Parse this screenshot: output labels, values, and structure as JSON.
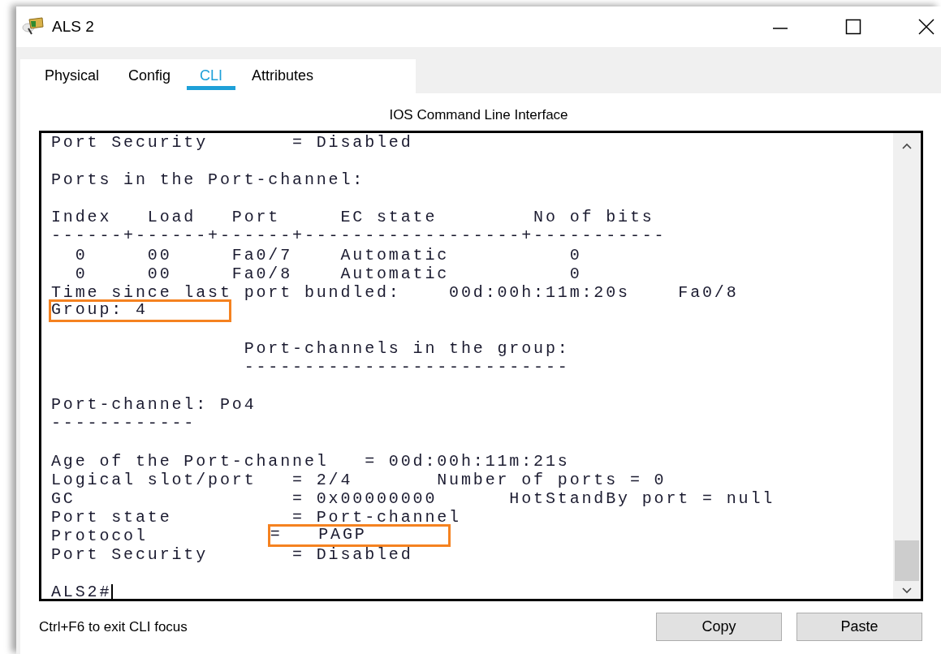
{
  "window": {
    "title": "ALS 2"
  },
  "tabs": [
    {
      "label": "Physical",
      "selected": false
    },
    {
      "label": "Config",
      "selected": false
    },
    {
      "label": "CLI",
      "selected": true
    },
    {
      "label": "Attributes",
      "selected": false
    }
  ],
  "panel_title": "IOS Command Line Interface",
  "terminal": {
    "lines": [
      {
        "kind": "text",
        "text": "Port Security       = Disabled"
      },
      {
        "kind": "blank"
      },
      {
        "kind": "text",
        "text": "Ports in the Port-channel:"
      },
      {
        "kind": "blank"
      },
      {
        "kind": "text",
        "text": "Index   Load   Port     EC state        No of bits"
      },
      {
        "kind": "text",
        "text": "------+------+------+------------------+-----------"
      },
      {
        "kind": "text",
        "text": "  0     00     Fa0/7    Automatic          0"
      },
      {
        "kind": "text",
        "text": "  0     00     Fa0/8    Automatic          0"
      },
      {
        "kind": "text",
        "text": "Time since last port bundled:    00d:00h:11m:20s    Fa0/8"
      },
      {
        "kind": "split",
        "segments": [
          {
            "text": "Group: 4",
            "highlighted": true
          }
        ]
      },
      {
        "kind": "blank"
      },
      {
        "kind": "text",
        "text": "                Port-channels in the group:"
      },
      {
        "kind": "text",
        "text": "                ---------------------------"
      },
      {
        "kind": "blank"
      },
      {
        "kind": "text",
        "text": "Port-channel: Po4"
      },
      {
        "kind": "text",
        "text": "------------"
      },
      {
        "kind": "blank"
      },
      {
        "kind": "text",
        "text": "Age of the Port-channel   = 00d:00h:11m:21s"
      },
      {
        "kind": "text",
        "text": "Logical slot/port   = 2/4       Number of ports = 0"
      },
      {
        "kind": "text",
        "text": "GC                  = 0x00000000      HotStandBy port = null"
      },
      {
        "kind": "text",
        "text": "Port state          = Port-channel"
      },
      {
        "kind": "split",
        "segments": [
          {
            "text": "Protocol",
            "highlighted": false
          },
          {
            "text": "=   PAGP",
            "highlighted": true
          }
        ]
      },
      {
        "kind": "text",
        "text": "Port Security       = Disabled"
      },
      {
        "kind": "blank"
      }
    ],
    "prompt": "ALS2#"
  },
  "hint": "Ctrl+F6 to exit CLI focus",
  "buttons": [
    "Copy",
    "Paste"
  ]
}
